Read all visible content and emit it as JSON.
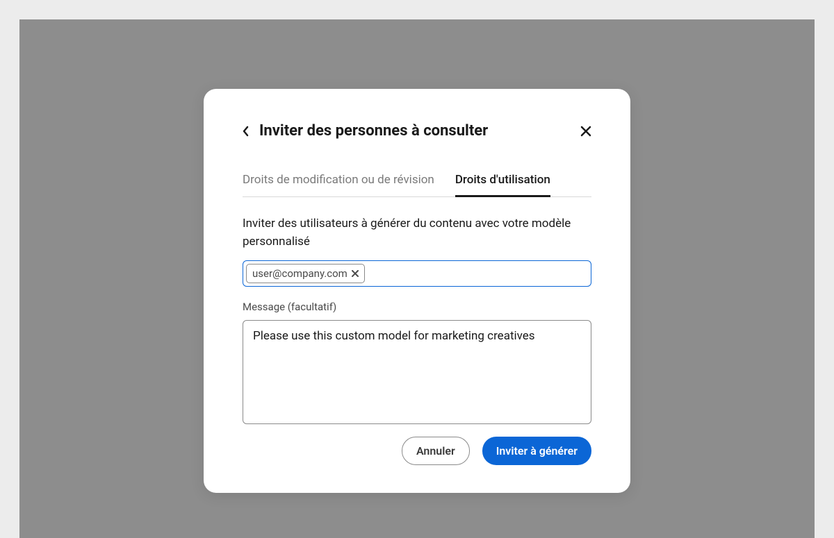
{
  "modal": {
    "title": "Inviter des personnes à consulter",
    "tabs": [
      {
        "label": "Droits de modification ou de révision",
        "active": false
      },
      {
        "label": "Droits d'utilisation",
        "active": true
      }
    ],
    "description": "Inviter des utilisateurs à générer du contenu avec votre modèle personnalisé",
    "email_chip": "user@company.com",
    "message_label": "Message (facultatif)",
    "message_value": "Please use this custom model for marketing creatives",
    "cancel_label": "Annuler",
    "invite_label": "Inviter à générer"
  }
}
